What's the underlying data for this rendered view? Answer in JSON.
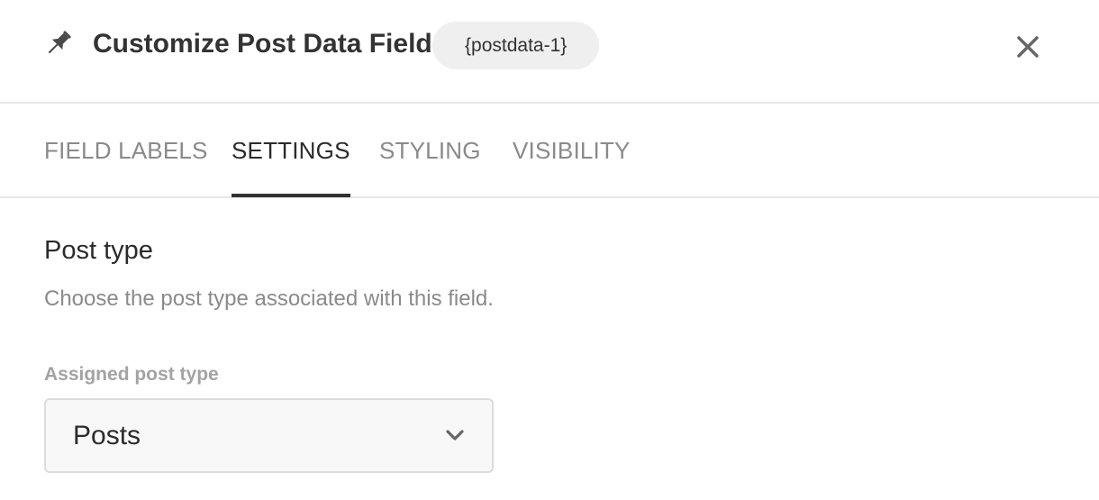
{
  "header": {
    "title": "Customize Post Data Field",
    "tag": "{postdata-1}",
    "pin_icon": "pin-icon",
    "close_icon": "close-icon"
  },
  "tabs": [
    {
      "label": "FIELD LABELS",
      "active": false
    },
    {
      "label": "SETTINGS",
      "active": true
    },
    {
      "label": "STYLING",
      "active": false
    },
    {
      "label": "VISIBILITY",
      "active": false
    }
  ],
  "section": {
    "title": "Post type",
    "description": "Choose the post type associated with this field."
  },
  "field": {
    "label": "Assigned post type",
    "selected_value": "Posts",
    "chevron_icon": "chevron-down-icon"
  },
  "colors": {
    "text_primary": "#333333",
    "text_muted": "#8a8a8a",
    "border": "#e6e6e6",
    "badge_bg": "#efefef",
    "select_bg": "#f8f8f8"
  }
}
